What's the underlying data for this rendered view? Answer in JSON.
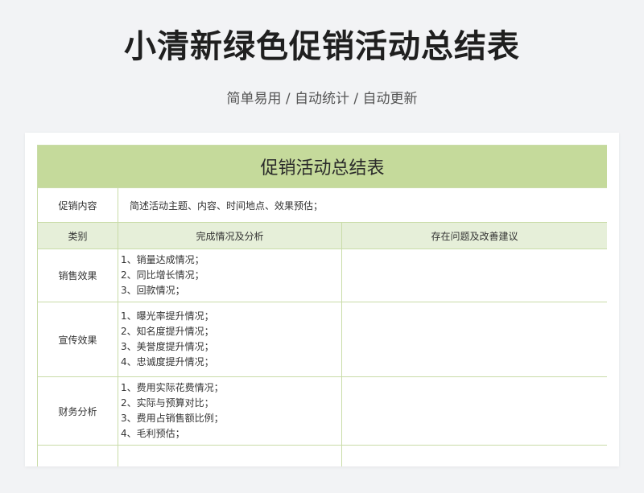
{
  "page": {
    "title": "小清新绿色促销活动总结表",
    "subtitle": "简单易用 / 自动统计 / 自动更新"
  },
  "table": {
    "title": "促销活动总结表",
    "intro_label": "促销内容",
    "intro_text": "简述活动主题、内容、时间地点、效果预估；",
    "headers": {
      "category": "类别",
      "analysis": "完成情况及分析",
      "issues": "存在问题及改善建议"
    },
    "rows": [
      {
        "category": "销售效果",
        "items": [
          "1、销量达成情况；",
          "2、同比增长情况；",
          "3、回款情况；"
        ]
      },
      {
        "category": "宣传效果",
        "items": [
          "1、曝光率提升情况；",
          "2、知名度提升情况；",
          "3、美誉度提升情况；",
          "4、忠诚度提升情况；"
        ]
      },
      {
        "category": "财务分析",
        "items": [
          "1、费用实际花费情况；",
          "2、实际与预算对比；",
          "3、费用占销售额比例；",
          "4、毛利预估；"
        ]
      }
    ]
  },
  "colors": {
    "title_bg": "#c5da9b",
    "header_bg": "#e6efd9",
    "border": "#c9dca8"
  }
}
